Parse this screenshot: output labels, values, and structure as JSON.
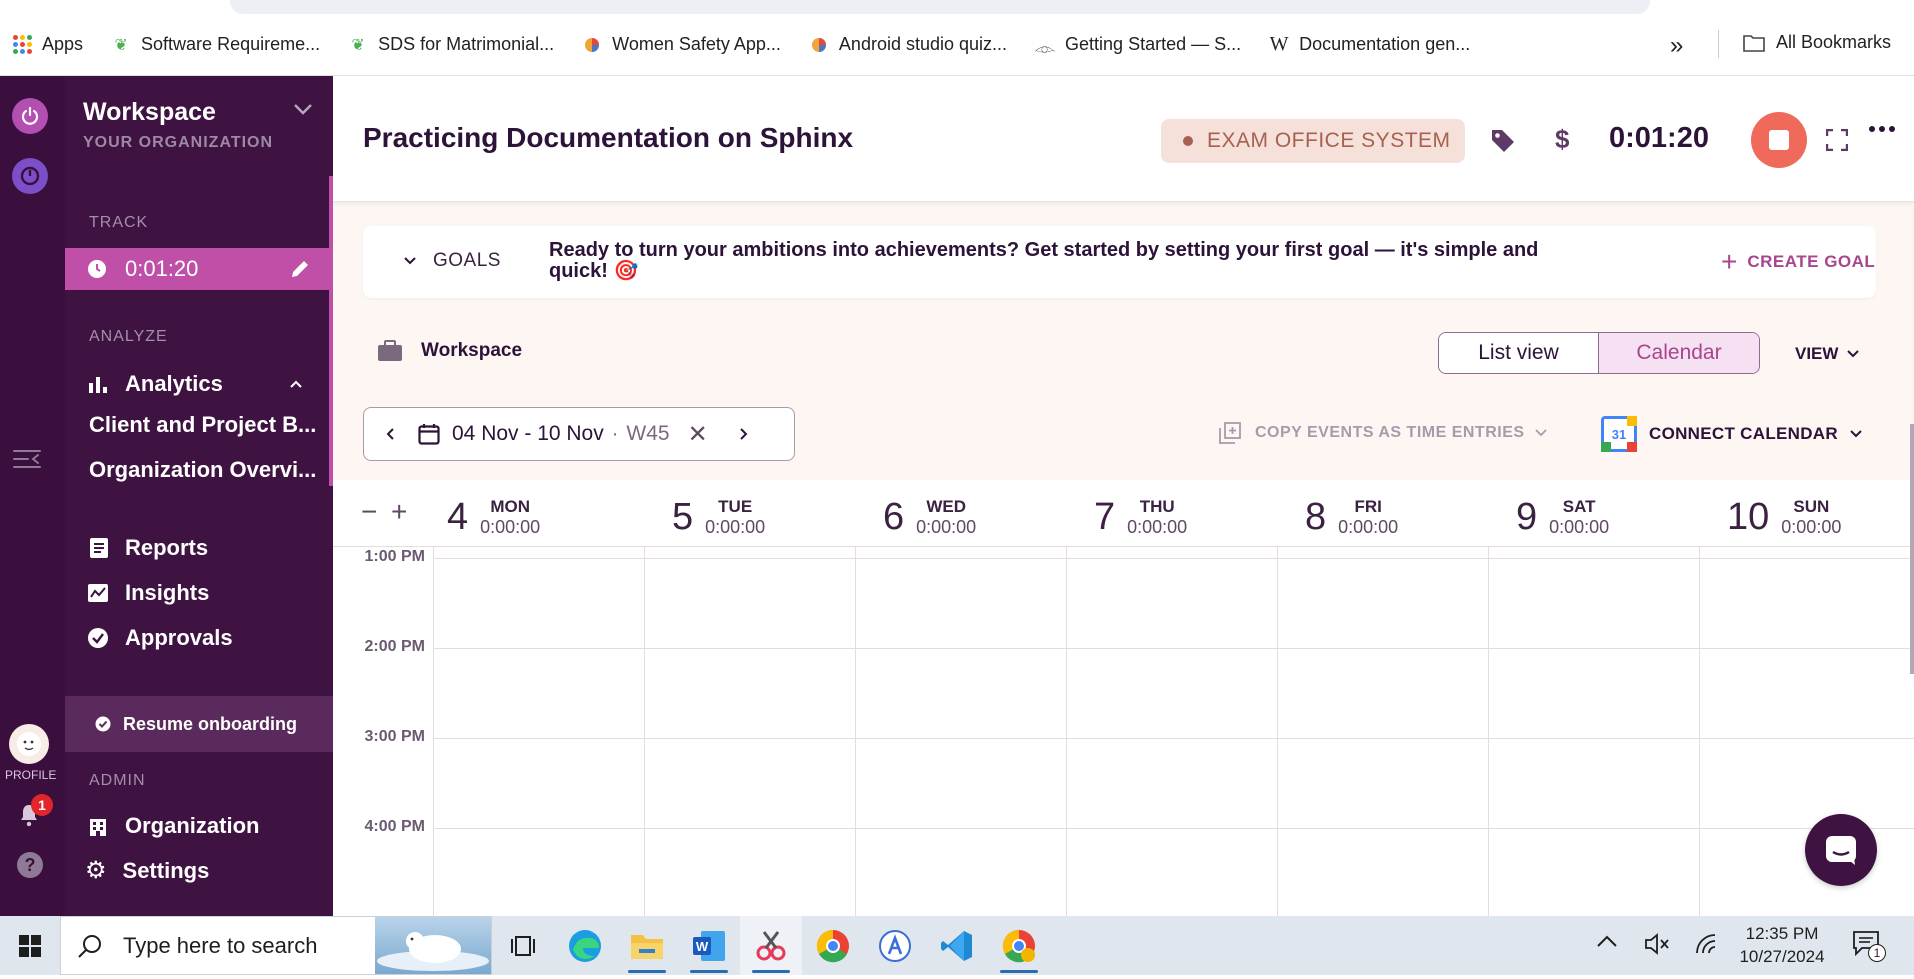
{
  "browser": {
    "bookmarks": [
      {
        "label": "Apps",
        "icon": "apps-grid-icon"
      },
      {
        "label": "Software Requireme...",
        "icon": "leaf-icon"
      },
      {
        "label": "SDS for Matrimonial...",
        "icon": "leaf-icon"
      },
      {
        "label": "Women Safety App...",
        "icon": "pie-icon"
      },
      {
        "label": "Android studio quiz...",
        "icon": "pie-icon"
      },
      {
        "label": "Getting Started — S...",
        "icon": "sphinx-icon"
      },
      {
        "label": "Documentation gen...",
        "icon": "wikipedia-icon"
      }
    ],
    "more": "»",
    "all_bookmarks": "All Bookmarks"
  },
  "rail": {
    "profile_label": "PROFILE",
    "notification_count": "1"
  },
  "sidebar": {
    "workspace_name": "Workspace",
    "org_label": "YOUR ORGANIZATION",
    "track_heading": "TRACK",
    "timer": "0:01:20",
    "analyze_heading": "ANALYZE",
    "analytics": "Analytics",
    "analytics_sub": [
      "Client and Project B...",
      "Organization Overvi..."
    ],
    "reports": "Reports",
    "insights": "Insights",
    "approvals": "Approvals",
    "resume_onboarding": "Resume onboarding",
    "admin_heading": "ADMIN",
    "organization": "Organization",
    "settings": "Settings"
  },
  "header": {
    "title": "Practicing Documentation on Sphinx",
    "project_chip": "EXAM OFFICE SYSTEM",
    "timer": "0:01:20"
  },
  "goals": {
    "label": "GOALS",
    "message": "Ready to turn your ambitions into achievements? Get started by setting your first goal — it's simple and quick! 🎯",
    "create": "CREATE GOAL"
  },
  "toolbar": {
    "workspace": "Workspace",
    "list_view": "List view",
    "calendar": "Calendar",
    "view": "VIEW",
    "date_range": "04 Nov - 10 Nov",
    "week": "W45",
    "copy_events": "COPY EVENTS AS TIME ENTRIES",
    "connect_calendar": "CONNECT CALENDAR",
    "gcal_day": "31"
  },
  "calendar": {
    "days": [
      {
        "num": "4",
        "name": "MON",
        "total": "0:00:00"
      },
      {
        "num": "5",
        "name": "TUE",
        "total": "0:00:00"
      },
      {
        "num": "6",
        "name": "WED",
        "total": "0:00:00"
      },
      {
        "num": "7",
        "name": "THU",
        "total": "0:00:00"
      },
      {
        "num": "8",
        "name": "FRI",
        "total": "0:00:00"
      },
      {
        "num": "9",
        "name": "SAT",
        "total": "0:00:00"
      },
      {
        "num": "10",
        "name": "SUN",
        "total": "0:00:00"
      }
    ],
    "hours": [
      "1:00 PM",
      "2:00 PM",
      "3:00 PM",
      "4:00 PM"
    ]
  },
  "taskbar": {
    "search_placeholder": "Type here to search",
    "time": "12:35 PM",
    "date": "10/27/2024",
    "notif_count": "1"
  },
  "colors": {
    "sidebar_bg": "#3f1341",
    "rail_bg": "#3a0f3e",
    "accent_pink": "#c04fa8",
    "stop_red": "#ef6a5a",
    "chip_bg": "#f6e1da"
  }
}
